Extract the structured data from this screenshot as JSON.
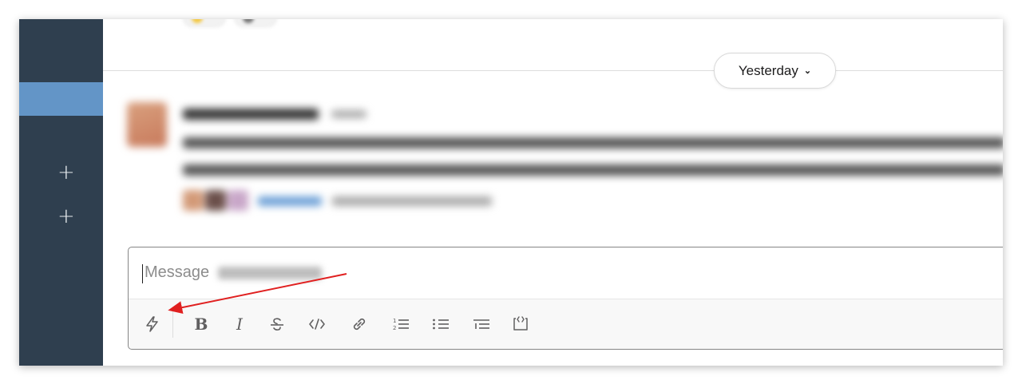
{
  "sidebar": {
    "add_buttons": [
      "+",
      "+"
    ]
  },
  "date_divider": {
    "label": "Yesterday",
    "chevron": "⌄"
  },
  "composer": {
    "placeholder": "Message"
  },
  "toolbar": {
    "bold_label": "B",
    "italic_label": "I",
    "buttons": [
      {
        "name": "shortcuts-lightning-icon"
      },
      {
        "name": "bold-icon"
      },
      {
        "name": "italic-icon"
      },
      {
        "name": "strikethrough-icon"
      },
      {
        "name": "code-icon"
      },
      {
        "name": "link-icon"
      },
      {
        "name": "ordered-list-icon"
      },
      {
        "name": "bulleted-list-icon"
      },
      {
        "name": "blockquote-icon"
      },
      {
        "name": "code-block-icon"
      }
    ]
  },
  "colors": {
    "sidebar_bg": "#2f3f4f",
    "sidebar_selected": "#6395c7",
    "annotation_arrow": "#e02020",
    "toolbar_icon": "#616061"
  }
}
